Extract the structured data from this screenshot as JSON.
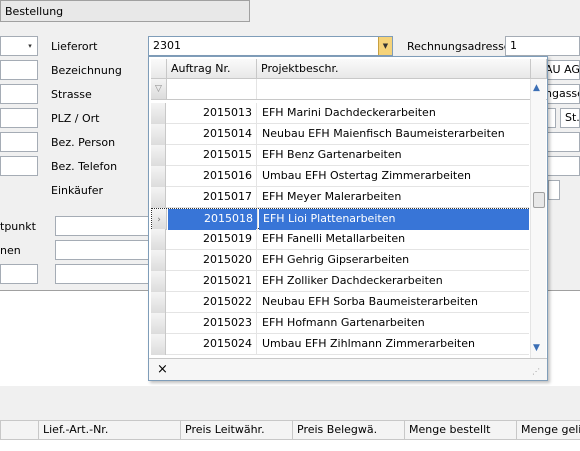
{
  "window": {
    "title": "Bestellung"
  },
  "form": {
    "left_combo_arrow": "▾",
    "lieferort_label": "Lieferort",
    "lieferort_value": "2301",
    "rechnungsadresse_label": "Rechnungsadresse",
    "rechnungsadresse_value": "1",
    "bezeichnung_label": "Bezeichnung",
    "strasse_label": "Strasse",
    "plz_ort_label": "PLZ / Ort",
    "bez_person_label": "Bez. Person",
    "bez_telefon_label": "Bez. Telefon",
    "einkaeufer_label": "Einkäufer",
    "right_field_1": "AU AG",
    "right_field_2": "ngasse",
    "right_field_3": "St.",
    "left_label_1": "tpunkt",
    "left_label_2": "nen"
  },
  "dropdown": {
    "columns": [
      "Auftrag Nr.",
      "Projektbeschr."
    ],
    "filter_icon": "funnel-icon",
    "close_glyph": "×",
    "rows": [
      {
        "nr": "2015013",
        "desc": "EFH Marini Dachdeckerarbeiten"
      },
      {
        "nr": "2015014",
        "desc": "Neubau EFH Maienfisch Baumeisterarbeiten"
      },
      {
        "nr": "2015015",
        "desc": "EFH Benz Gartenarbeiten"
      },
      {
        "nr": "2015016",
        "desc": "Umbau EFH Ostertag Zimmerarbeiten"
      },
      {
        "nr": "2015017",
        "desc": "EFH Meyer Malerarbeiten"
      },
      {
        "nr": "2015018",
        "desc": "EFH Lioi Plattenarbeiten"
      },
      {
        "nr": "2015019",
        "desc": "EFH Fanelli Metallarbeiten"
      },
      {
        "nr": "2015020",
        "desc": "EFH Gehrig Gipserarbeiten"
      },
      {
        "nr": "2015021",
        "desc": "EFH Zolliker Dachdeckerarbeiten"
      },
      {
        "nr": "2015022",
        "desc": "Neubau EFH Sorba Baumeisterarbeiten"
      },
      {
        "nr": "2015023",
        "desc": "EFH Hofmann Gartenarbeiten"
      },
      {
        "nr": "2015024",
        "desc": "Umbau EFH Zihlmann Zimmerarbeiten"
      }
    ],
    "selected_nr": "2015018"
  },
  "grid": {
    "columns": [
      "Lief.-Art.-Nr.",
      "Preis Leitwähr.",
      "Preis Belegwä.",
      "Menge bestellt",
      "Menge gelief"
    ]
  },
  "colors": {
    "selection": "#3875d7",
    "combo_button": "#f5d37a"
  }
}
